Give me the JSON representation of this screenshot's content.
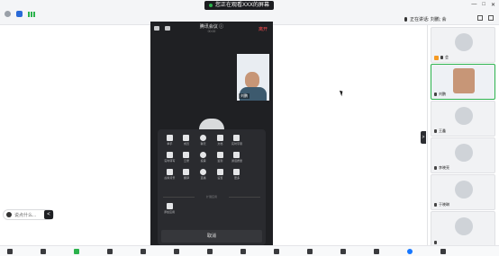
{
  "topbar": {
    "share_banner": "您正在观看XXX的屏幕",
    "speaking_label": "正在讲话: 刘鹏; 会",
    "window_controls": [
      "—",
      "□",
      "✕"
    ],
    "left_icons": [
      "info-icon",
      "shield-icon",
      "signal-icon"
    ]
  },
  "phone": {
    "title": "腾讯会议 ⓘ",
    "subtitle": "00:00",
    "exit_label": "离开",
    "self_view_name": "刘鹏"
  },
  "more_sheet": {
    "items": [
      {
        "icon": "hand-icon",
        "label": "举手"
      },
      {
        "icon": "member-icon",
        "label": "成员"
      },
      {
        "icon": "chat-icon",
        "label": "聊天"
      },
      {
        "icon": "doc-icon",
        "label": "文档"
      },
      {
        "icon": "caption-icon",
        "label": "实时字幕"
      },
      {
        "icon": "",
        "label": ""
      },
      {
        "icon": "minutes-icon",
        "label": "实时转写"
      },
      {
        "icon": "record-icon",
        "label": "云录"
      },
      {
        "icon": "vote-icon",
        "label": "投票"
      },
      {
        "icon": "signin-icon",
        "label": "签到"
      },
      {
        "icon": "report-icon",
        "label": "通话质量"
      },
      {
        "icon": "",
        "label": ""
      },
      {
        "icon": "beauty-icon",
        "label": "虚拟背景"
      },
      {
        "icon": "headset-icon",
        "label": "翻译"
      },
      {
        "icon": "live-icon",
        "label": "直播"
      },
      {
        "icon": "settings-icon",
        "label": "设置"
      },
      {
        "icon": "more-icon",
        "label": "更多"
      },
      {
        "icon": "",
        "label": ""
      }
    ],
    "section_label": "扩展应用",
    "extension": {
      "icon": "apps-icon",
      "label": "添加应用"
    },
    "cancel_label": "取消"
  },
  "chat": {
    "placeholder": "说点什么...",
    "collapse_glyph": "<"
  },
  "sidebar_toggle": ">",
  "participants": [
    {
      "name": "会",
      "kind": "avatar",
      "host": true
    },
    {
      "name": "刘鹏",
      "kind": "video",
      "active": true
    },
    {
      "name": "王鑫",
      "kind": "avatar"
    },
    {
      "name": "李晓亮",
      "kind": "avatar"
    },
    {
      "name": "于晓琳",
      "kind": "avatar"
    },
    {
      "name": "",
      "kind": "avatar"
    }
  ],
  "toolbar_icons": [
    "mic-icon",
    "video-icon",
    "share-icon",
    "member-icon",
    "chat-icon",
    "record-icon",
    "apps-icon",
    "reaction-icon",
    "settings-icon",
    "view-icon",
    "layout-icon",
    "fullscreen-icon",
    "help-icon",
    "leave-icon"
  ],
  "colors": {
    "accent": "#2bb24c",
    "danger": "#ff4d4f",
    "brand": "#1677ff"
  }
}
